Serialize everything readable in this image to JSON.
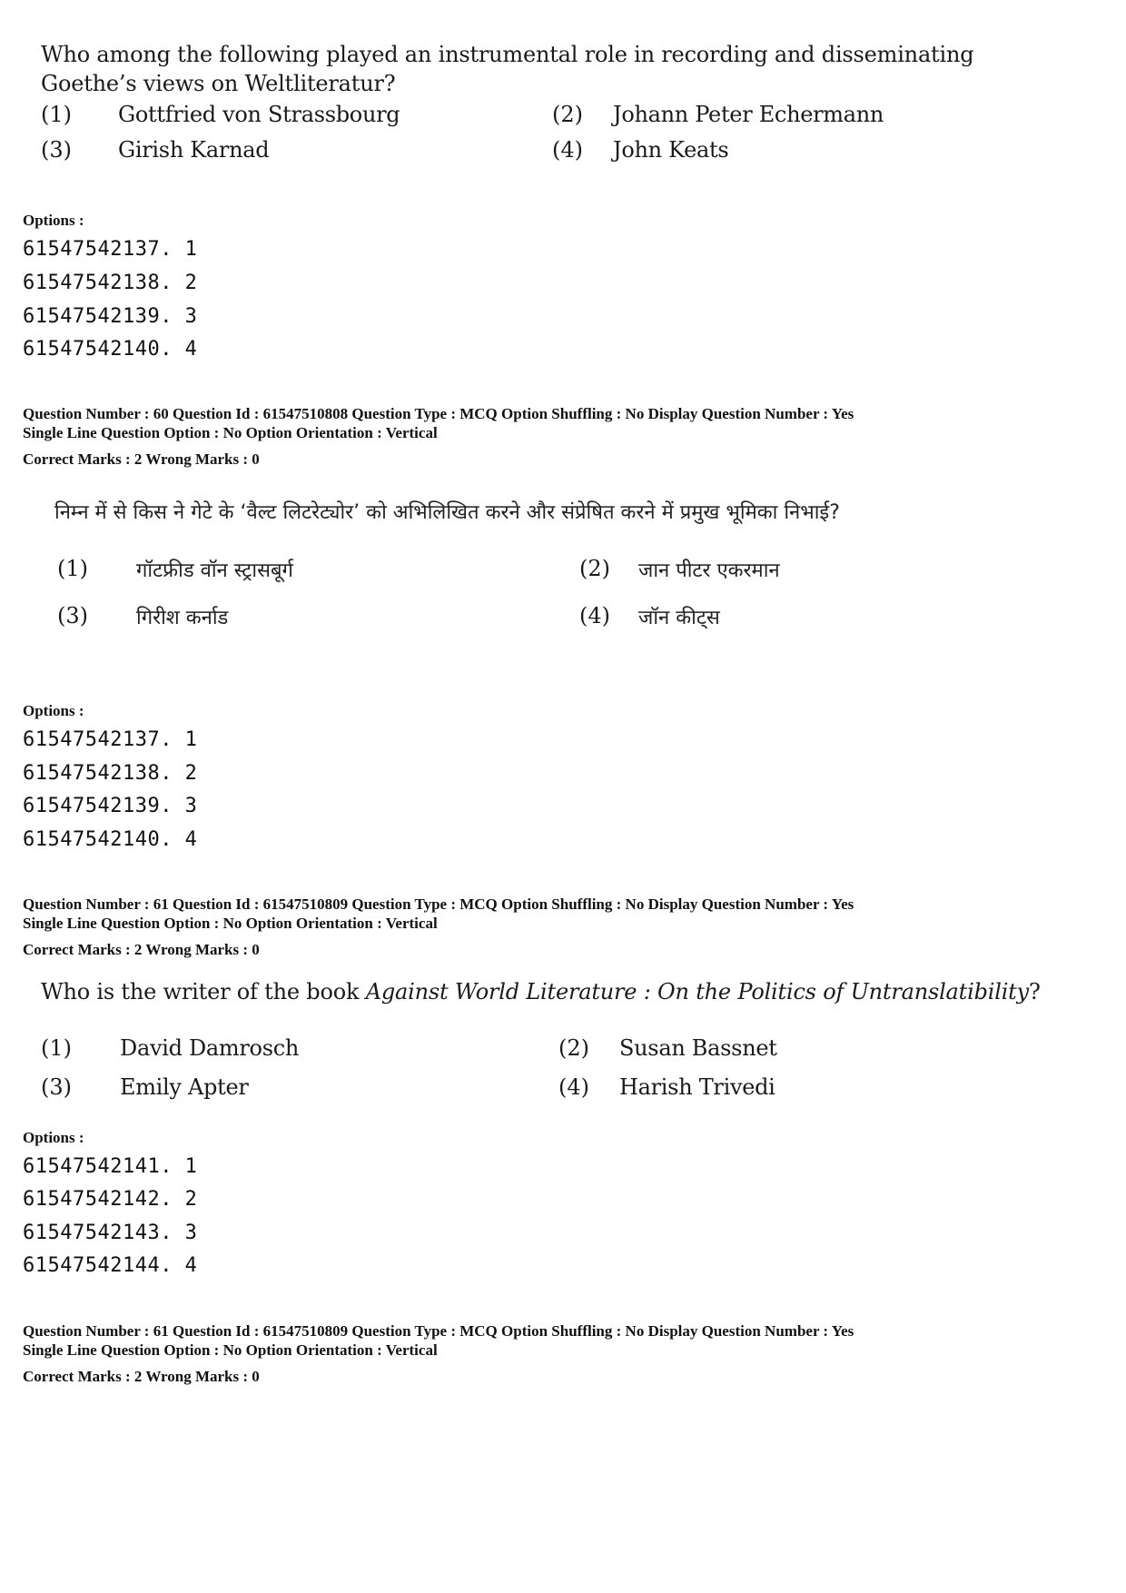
{
  "blocks": [
    {
      "question_en": {
        "text_line1": "Who among the following played an instrumental role in recording and disseminating",
        "text_line2": "Goethe’s views on Weltliteratur?",
        "options": [
          {
            "num": "(1)",
            "text": "Gottfried von Strassbourg"
          },
          {
            "num": "(2)",
            "text": "Johann Peter Echermann"
          },
          {
            "num": "(3)",
            "text": "Girish Karnad"
          },
          {
            "num": "(4)",
            "text": "John Keats"
          }
        ]
      },
      "options_label": "Options :",
      "option_ids": [
        "61547542137. 1",
        "61547542138. 2",
        "61547542139. 3",
        "61547542140. 4"
      ]
    },
    {
      "meta": {
        "line1": "Question Number : 60  Question Id : 61547510808  Question Type : MCQ  Option Shuffling : No  Display Question Number : Yes",
        "line2": "Single Line Question Option : No  Option Orientation : Vertical",
        "marks": "Correct Marks : 2  Wrong Marks : 0"
      },
      "question_hi": {
        "text": "निम्न में से किस ने गेटे के ‘वैल्ट लिटरेट्योर’ को अभिलिखित करने और संप्रेषित करने में प्रमुख भूमिका निभाई?",
        "options": [
          {
            "num": "(1)",
            "text": "गॉटफ्रीड वॉन स्ट्रासबूर्ग"
          },
          {
            "num": "(2)",
            "text": "जान पीटर एकरमान"
          },
          {
            "num": "(3)",
            "text": "गिरीश कर्नाड"
          },
          {
            "num": "(4)",
            "text": "जॉन कीट्स"
          }
        ]
      },
      "options_label": "Options :",
      "option_ids": [
        "61547542137. 1",
        "61547542138. 2",
        "61547542139. 3",
        "61547542140. 4"
      ]
    },
    {
      "meta": {
        "line1": "Question Number : 61  Question Id : 61547510809  Question Type : MCQ  Option Shuffling : No  Display Question Number : Yes",
        "line2": "Single Line Question Option : No  Option Orientation : Vertical",
        "marks": "Correct Marks : 2  Wrong Marks : 0"
      },
      "question_en": {
        "text_prefix": "Who is the writer of the book ",
        "text_italic": "Against World Literature : On the Politics of Untranslatibility",
        "text_suffix": "?",
        "options": [
          {
            "num": "(1)",
            "text": "David Damrosch"
          },
          {
            "num": "(2)",
            "text": "Susan Bassnet"
          },
          {
            "num": "(3)",
            "text": "Emily Apter"
          },
          {
            "num": "(4)",
            "text": "Harish Trivedi"
          }
        ]
      },
      "options_label": "Options :",
      "option_ids": [
        "61547542141. 1",
        "61547542142. 2",
        "61547542143. 3",
        "61547542144. 4"
      ]
    },
    {
      "meta": {
        "line1": "Question Number : 61  Question Id : 61547510809  Question Type : MCQ  Option Shuffling : No  Display Question Number : Yes",
        "line2": "Single Line Question Option : No  Option Orientation : Vertical",
        "marks": "Correct Marks : 2  Wrong Marks : 0"
      }
    }
  ]
}
